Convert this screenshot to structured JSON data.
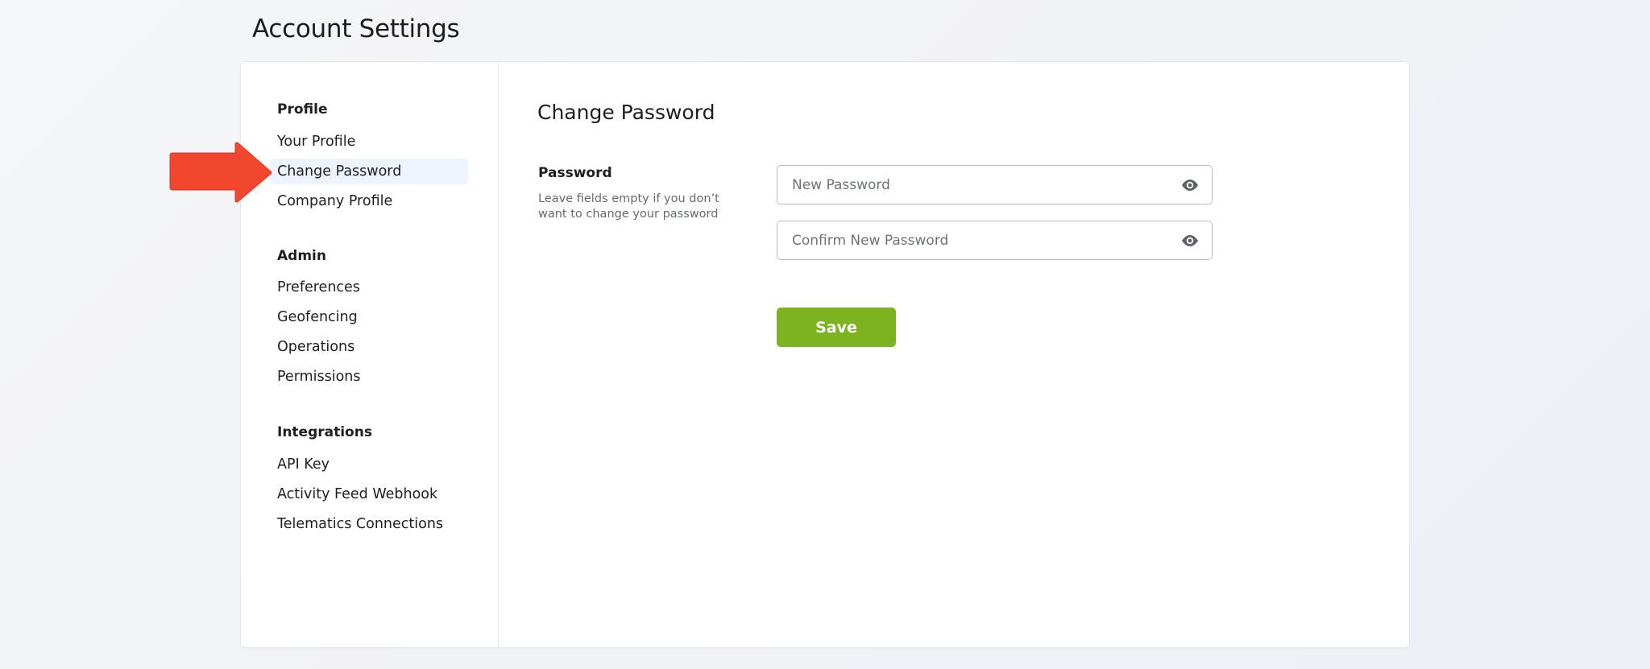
{
  "page": {
    "title": "Account Settings"
  },
  "sidebar": {
    "sections": [
      {
        "heading": "Profile",
        "items": [
          {
            "label": "Your Profile",
            "active": false
          },
          {
            "label": "Change Password",
            "active": true
          },
          {
            "label": "Company Profile",
            "active": false
          }
        ]
      },
      {
        "heading": "Admin",
        "items": [
          {
            "label": "Preferences",
            "active": false
          },
          {
            "label": "Geofencing",
            "active": false
          },
          {
            "label": "Operations",
            "active": false
          },
          {
            "label": "Permissions",
            "active": false
          }
        ]
      },
      {
        "heading": "Integrations",
        "items": [
          {
            "label": "API Key",
            "active": false
          },
          {
            "label": "Activity Feed Webhook",
            "active": false
          },
          {
            "label": "Telematics Connections",
            "active": false
          }
        ]
      }
    ]
  },
  "main": {
    "title": "Change Password",
    "password_section": {
      "label": "Password",
      "help": "Leave fields empty if you don’t want to change your password",
      "new_password": {
        "placeholder": "New Password",
        "value": "",
        "icon": "eye-icon"
      },
      "confirm_password": {
        "placeholder": "Confirm New Password",
        "value": "",
        "icon": "eye-icon"
      }
    },
    "save_label": "Save"
  },
  "annotation": {
    "type": "arrow",
    "points_to": "Change Password",
    "color": "#f2472f"
  },
  "colors": {
    "accent_green": "#7db321",
    "active_item_bg": "#eef4fd",
    "arrow_red": "#f2472f"
  }
}
